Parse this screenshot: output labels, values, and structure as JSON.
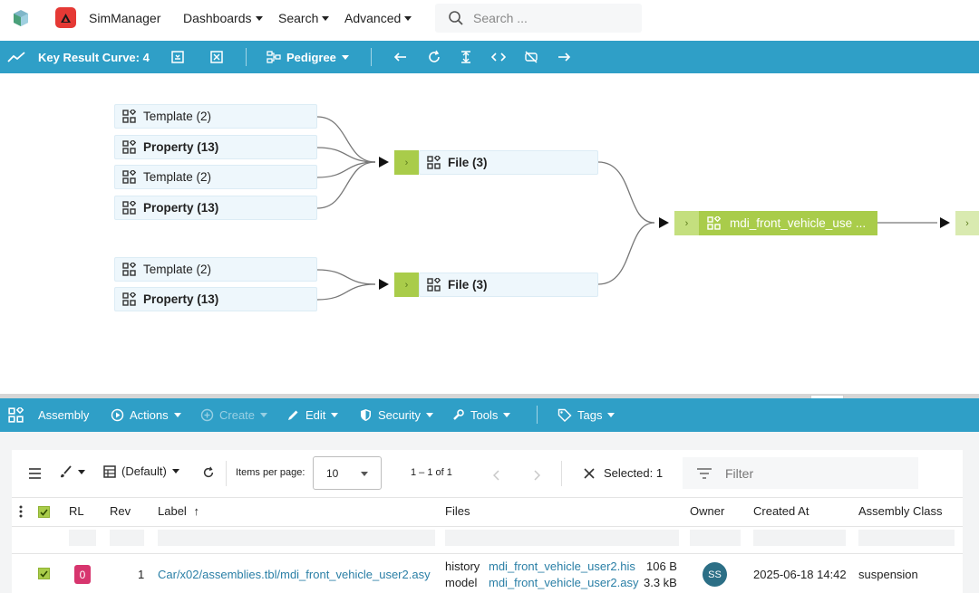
{
  "topbar": {
    "app_name": "SimManager",
    "menus": [
      "Dashboards",
      "Search",
      "Advanced"
    ],
    "search_placeholder": "Search ..."
  },
  "curve_toolbar": {
    "title": "Key Result Curve: 4",
    "pedigree_label": "Pedigree",
    "icons": [
      "chart-line-icon",
      "save-icon",
      "clear-icon",
      "pedigree-icon",
      "arrow-left-icon",
      "refresh-icon",
      "fit-height-icon",
      "code-icon",
      "hide-icon",
      "arrow-right-icon"
    ]
  },
  "pedigree": {
    "group1": [
      {
        "label": "Template (2)",
        "bold": false
      },
      {
        "label": "Property (13)",
        "bold": true
      },
      {
        "label": "Template (2)",
        "bold": false
      },
      {
        "label": "Property (13)",
        "bold": true
      }
    ],
    "group2": [
      {
        "label": "Template (2)",
        "bold": false
      },
      {
        "label": "Property (13)",
        "bold": true
      }
    ],
    "file1_label": "File (3)",
    "file2_label": "File (3)",
    "target_label": "mdi_front_vehicle_use ...",
    "expander_glyph": "›"
  },
  "assembly_toolbar": {
    "title": "Assembly",
    "items": [
      {
        "label": "Actions",
        "enabled": true
      },
      {
        "label": "Create",
        "enabled": false
      },
      {
        "label": "Edit",
        "enabled": true
      },
      {
        "label": "Security",
        "enabled": true
      },
      {
        "label": "Tools",
        "enabled": true
      },
      {
        "label": "Tags",
        "enabled": true
      }
    ]
  },
  "table_controls": {
    "view_label": "(Default)",
    "items_per_page_label": "Items per page:",
    "items_per_page_value": "10",
    "range_label": "1 – 1 of 1",
    "selected_label": "Selected: 1",
    "filter_placeholder": "Filter"
  },
  "table": {
    "columns": [
      "RL",
      "Rev",
      "Label",
      "Files",
      "Owner",
      "Created At",
      "Assembly Class"
    ],
    "sort_indicator": "↑",
    "rows": [
      {
        "rl": "0",
        "rev": "1",
        "label": "Car/x02/assemblies.tbl/mdi_front_vehicle_user2.asy",
        "files": [
          {
            "role": "history",
            "name": "mdi_front_vehicle_user2.his",
            "size": "106 B"
          },
          {
            "role": "model",
            "name": "mdi_front_vehicle_user2.asy",
            "size": "3.3 kB"
          }
        ],
        "owner": "SS",
        "created_at": "2025-06-18 14:42",
        "assembly_class": "suspension"
      }
    ]
  },
  "colors": {
    "teal": "#2f9fc7",
    "green": "#a9cc4a",
    "node_bg": "#eef7fc",
    "badge": "#d7356e",
    "avatar": "#2c6f86"
  }
}
